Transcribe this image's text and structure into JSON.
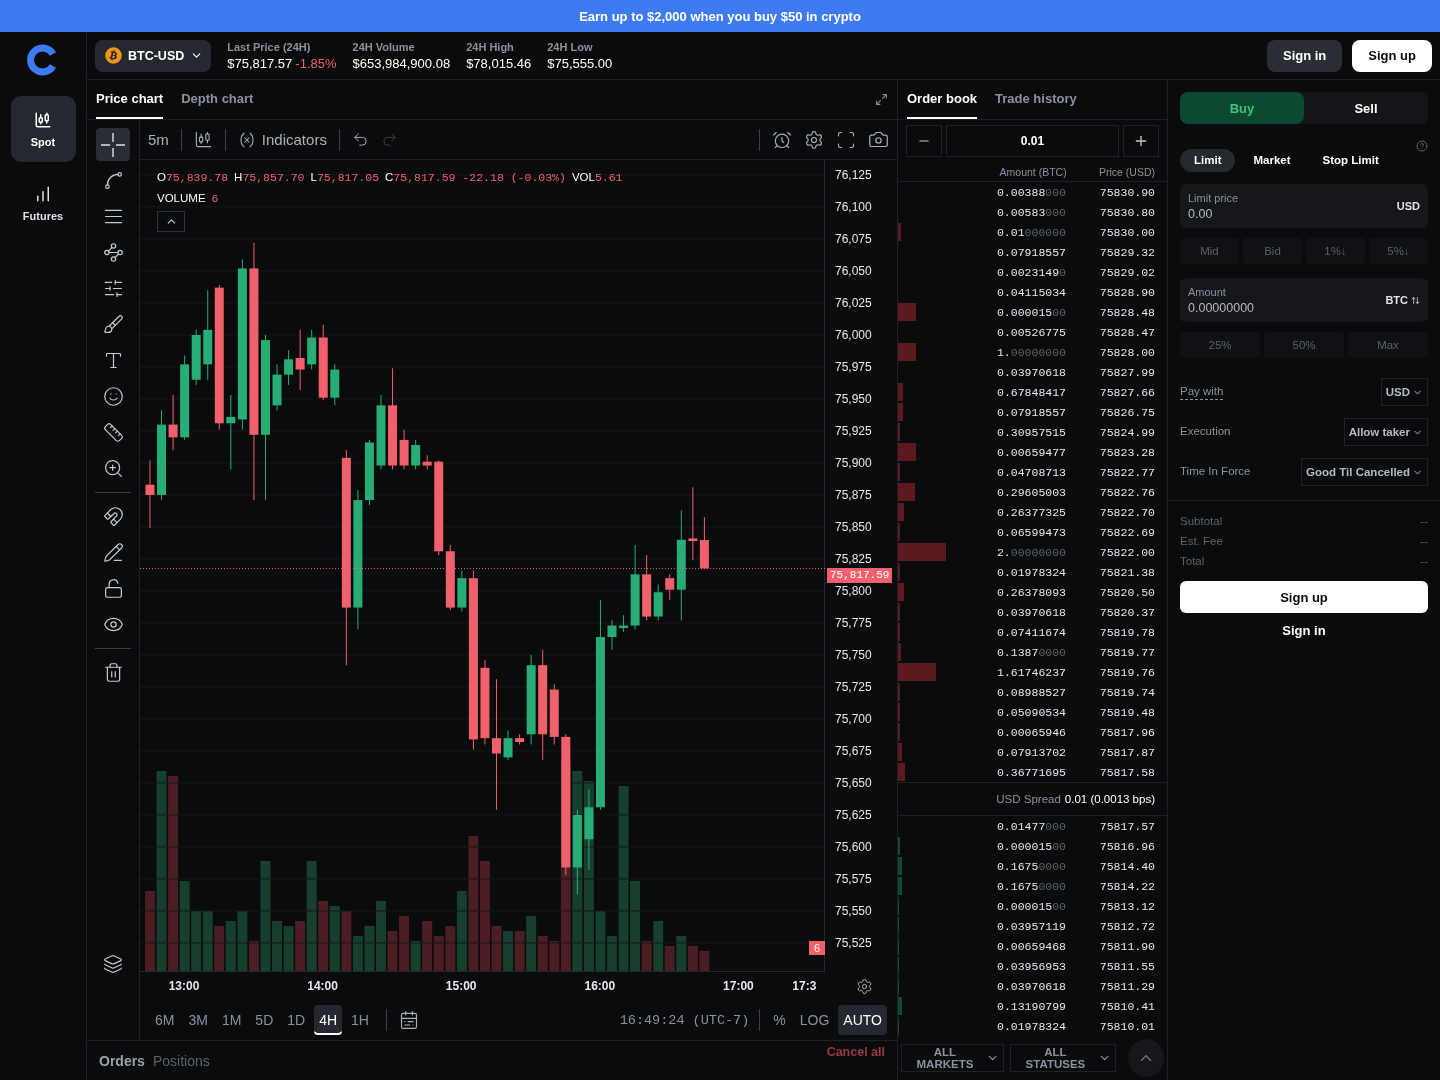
{
  "banner": {
    "text": "Earn up to $2,000 when you buy $50 in crypto"
  },
  "nav": [
    {
      "label": "Spot",
      "selected": true
    },
    {
      "label": "Futures",
      "selected": false
    }
  ],
  "header": {
    "pair": "BTC-USD",
    "stats": [
      {
        "label": "Last Price (24H)",
        "value": "$75,817.57",
        "change": "-1.85%"
      },
      {
        "label": "24H Volume",
        "value": "$653,984,900.08"
      },
      {
        "label": "24H High",
        "value": "$78,015.46"
      },
      {
        "label": "24H Low",
        "value": "$75,555.00"
      }
    ],
    "sign_in": "Sign in",
    "sign_up": "Sign up"
  },
  "chart": {
    "tabs": [
      {
        "label": "Price chart",
        "selected": true
      },
      {
        "label": "Depth chart",
        "selected": false
      }
    ],
    "interval": "5m",
    "indicators": "Indicators",
    "drawing_tools": [
      {
        "selected": true
      },
      {
        "selected": false
      },
      {
        "selected": false
      },
      {
        "selected": false
      },
      {
        "selected": false
      },
      {
        "selected": false
      },
      {
        "selected": false
      },
      {
        "selected": false
      },
      {
        "selected": false
      },
      {
        "selected": false
      },
      {
        "selected": false
      },
      {
        "selected": false
      },
      {
        "selected": false
      },
      {
        "selected": false
      },
      {
        "selected": false
      }
    ],
    "legend": [
      {
        "label": "O",
        "value": "75,839.78"
      },
      {
        "label": "H",
        "value": "75,857.70"
      },
      {
        "label": "L",
        "value": "75,817.05"
      },
      {
        "label": "C",
        "value": "75,817.59 -22.18 (-0.03%)"
      },
      {
        "label": "VOL",
        "value": "5.61"
      }
    ],
    "volume_legend": {
      "label": "VOLUME",
      "value": "6"
    },
    "chart_data": {
      "type": "candlestick",
      "x": [
        12.75,
        12.8333,
        12.9167,
        13,
        13.0833,
        13.1667,
        13.25,
        13.3333,
        13.4167,
        13.5,
        13.5833,
        13.6667,
        13.75,
        13.8333,
        13.9167,
        14,
        14.0833,
        14.1667,
        14.25,
        14.3333,
        14.4167,
        14.5,
        14.5833,
        14.6667,
        14.75,
        14.8333,
        14.9167,
        15,
        15.0833,
        15.1667,
        15.25,
        15.3333,
        15.4167,
        15.5,
        15.5833,
        15.6667,
        15.75,
        15.8333,
        15.9167,
        16,
        16.0833,
        16.1667,
        16.25,
        16.3333,
        16.4167,
        16.5,
        16.5833,
        16.6667,
        16.75
      ],
      "ohlc": [
        [
          75883,
          75902,
          75849,
          75875
        ],
        [
          75875,
          75941,
          75871,
          75930
        ],
        [
          75930,
          75953,
          75910,
          75920
        ],
        [
          75920,
          75984,
          75918,
          75977
        ],
        [
          75965,
          76004,
          75961,
          76000
        ],
        [
          75977,
          76035,
          75965,
          76004
        ],
        [
          76037,
          76039,
          75926,
          75931
        ],
        [
          75931,
          75953,
          75895,
          75936
        ],
        [
          75934,
          76059,
          75926,
          76052
        ],
        [
          76052,
          76072,
          75871,
          75922
        ],
        [
          75922,
          76000,
          75871,
          75996
        ],
        [
          75945,
          75977,
          75941,
          75969
        ],
        [
          75969,
          75988,
          75961,
          75981
        ],
        [
          75982,
          76004,
          75957,
          75973
        ],
        [
          75977,
          76004,
          75973,
          75998
        ],
        [
          75998,
          76008,
          75949,
          75951
        ],
        [
          75951,
          75977,
          75945,
          75973
        ],
        [
          75904,
          75910,
          75742,
          75787
        ],
        [
          75787,
          75879,
          75770,
          75871
        ],
        [
          75871,
          75918,
          75867,
          75916
        ],
        [
          75898,
          75953,
          75895,
          75945
        ],
        [
          75945,
          75974,
          75895,
          75898
        ],
        [
          75918,
          75926,
          75895,
          75898
        ],
        [
          75898,
          75918,
          75895,
          75914
        ],
        [
          75901,
          75906,
          75895,
          75898
        ],
        [
          75901,
          75902,
          75828,
          75831
        ],
        [
          75831,
          75836,
          75785,
          75787
        ],
        [
          75787,
          75816,
          75784,
          75810
        ],
        [
          75810,
          75816,
          75676,
          75684
        ],
        [
          75740,
          75746,
          75680,
          75685
        ],
        [
          75685,
          75731,
          75629,
          75673
        ],
        [
          75670,
          75691,
          75668,
          75685
        ],
        [
          75685,
          75688,
          75680,
          75682
        ],
        [
          75688,
          75750,
          75680,
          75742
        ],
        [
          75742,
          75754,
          75668,
          75688
        ],
        [
          75723,
          75727,
          75680,
          75686
        ],
        [
          75686,
          75688,
          75578,
          75584
        ],
        [
          75584,
          75629,
          75563,
          75625
        ],
        [
          75606,
          75645,
          75582,
          75631
        ],
        [
          75631,
          75793,
          75629,
          75764
        ],
        [
          75764,
          75777,
          75754,
          75773
        ],
        [
          75771,
          75781,
          75768,
          75773
        ],
        [
          75773,
          75836,
          75770,
          75813
        ],
        [
          75813,
          75828,
          75777,
          75780
        ],
        [
          75780,
          75805,
          75777,
          75799
        ],
        [
          75810,
          75813,
          75793,
          75801
        ],
        [
          75801,
          75863,
          75777,
          75840
        ],
        [
          75841,
          75881,
          75824,
          75839
        ],
        [
          75839.78,
          75857.7,
          75817.05,
          75817.59
        ]
      ],
      "xlim": [
        12.678,
        17.62
      ],
      "ylim": [
        75502.3,
        76136.7
      ],
      "grid": true,
      "ref_lines": [
        {
          "axis": "y",
          "value": 75817.59
        }
      ],
      "yticks": [
        {
          "value": 76125,
          "label": "76,125"
        },
        {
          "value": 76100,
          "label": "76,100"
        },
        {
          "value": 76075,
          "label": "76,075"
        },
        {
          "value": 76050,
          "label": "76,050"
        },
        {
          "value": 76025,
          "label": "76,025"
        },
        {
          "value": 76000,
          "label": "76,000"
        },
        {
          "value": 75975,
          "label": "75,975"
        },
        {
          "value": 75950,
          "label": "75,950"
        },
        {
          "value": 75925,
          "label": "75,925"
        },
        {
          "value": 75900,
          "label": "75,900"
        },
        {
          "value": 75875,
          "label": "75,875"
        },
        {
          "value": 75850,
          "label": "75,850"
        },
        {
          "value": 75825,
          "label": "75,825"
        },
        {
          "value": 75800,
          "label": "75,800"
        },
        {
          "value": 75775,
          "label": "75,775"
        },
        {
          "value": 75750,
          "label": "75,750"
        },
        {
          "value": 75725,
          "label": "75,725"
        },
        {
          "value": 75700,
          "label": "75,700"
        },
        {
          "value": 75675,
          "label": "75,675"
        },
        {
          "value": 75650,
          "label": "75,650"
        },
        {
          "value": 75625,
          "label": "75,625"
        },
        {
          "value": 75600,
          "label": "75,600"
        },
        {
          "value": 75575,
          "label": "75,575"
        },
        {
          "value": 75550,
          "label": "75,550"
        },
        {
          "value": 75525,
          "label": "75,525"
        }
      ],
      "xticks": [
        {
          "value": 13,
          "label": "13:00"
        },
        {
          "value": 14,
          "label": "14:00"
        },
        {
          "value": 15,
          "label": "15:00"
        },
        {
          "value": 16,
          "label": "16:00"
        },
        {
          "value": 17,
          "label": "17:00"
        },
        {
          "value": 17.5,
          "label": "17:3"
        }
      ]
    },
    "current_price_tag": "75,817.59",
    "volume_tag": "6",
    "ranges": [
      {
        "label": "6M",
        "selected": false
      },
      {
        "label": "3M",
        "selected": false
      },
      {
        "label": "1M",
        "selected": false
      },
      {
        "label": "5D",
        "selected": false
      },
      {
        "label": "1D",
        "selected": false
      },
      {
        "label": "4H",
        "selected": true
      },
      {
        "label": "1H",
        "selected": false
      }
    ],
    "timestamp": "16:49:24 (UTC-7)",
    "scale_options": [
      {
        "label": "%",
        "selected": false
      },
      {
        "label": "LOG",
        "selected": false
      },
      {
        "label": "AUTO",
        "selected": true
      }
    ]
  },
  "orders": {
    "tabs": [
      {
        "label": "Orders",
        "selected": true
      },
      {
        "label": "Positions",
        "selected": false
      }
    ],
    "cancel_all": "Cancel all",
    "filters": [
      "ALL MARKETS",
      "ALL STATUSES"
    ]
  },
  "order_book": {
    "tabs": [
      {
        "label": "Order book",
        "selected": true
      },
      {
        "label": "Trade history",
        "selected": false
      }
    ],
    "tick_size": "0.01",
    "columns": [
      "Amount (BTC)",
      "Price (USD)"
    ],
    "asks": [
      {
        "amount": "0.00388",
        "pad": "000",
        "price": "75830.90"
      },
      {
        "amount": "0.00583",
        "pad": "000",
        "price": "75830.80"
      },
      {
        "amount": "0.01",
        "pad": "000000",
        "price": "75830.00"
      },
      {
        "amount": "0.07918557",
        "price": "75829.32"
      },
      {
        "amount": "0.0023149",
        "pad": "0",
        "price": "75829.02"
      },
      {
        "amount": "0.04115034",
        "price": "75828.90"
      },
      {
        "amount": "0.000015",
        "pad": "00",
        "price": "75828.48"
      },
      {
        "amount": "0.00526775",
        "price": "75828.47"
      },
      {
        "amount": "1.",
        "pad": "00000000",
        "price": "75828.00"
      },
      {
        "amount": "0.03970618",
        "price": "75827.99"
      },
      {
        "amount": "0.67848417",
        "price": "75827.66"
      },
      {
        "amount": "0.07918557",
        "price": "75826.75"
      },
      {
        "amount": "0.30957515",
        "price": "75824.99"
      },
      {
        "amount": "0.00659477",
        "price": "75823.28"
      },
      {
        "amount": "0.04708713",
        "price": "75822.77"
      },
      {
        "amount": "0.29605003",
        "price": "75822.76"
      },
      {
        "amount": "0.26377325",
        "price": "75822.70"
      },
      {
        "amount": "0.06599473",
        "price": "75822.69"
      },
      {
        "amount": "2.",
        "pad": "00000000",
        "price": "75822.00"
      },
      {
        "amount": "0.01978324",
        "price": "75821.38"
      },
      {
        "amount": "0.26378093",
        "price": "75820.50"
      },
      {
        "amount": "0.03970618",
        "price": "75820.37"
      },
      {
        "amount": "0.07411674",
        "price": "75819.78"
      },
      {
        "amount": "0.1387",
        "pad": "0000",
        "price": "75819.77"
      },
      {
        "amount": "1.61746237",
        "price": "75819.76"
      },
      {
        "amount": "0.08988527",
        "price": "75819.74"
      },
      {
        "amount": "0.05090534",
        "price": "75819.48"
      },
      {
        "amount": "0.00065946",
        "price": "75817.96"
      },
      {
        "amount": "0.07913702",
        "price": "75817.87"
      },
      {
        "amount": "0.36771695",
        "price": "75817.58"
      }
    ],
    "spread": {
      "label": "USD Spread",
      "value": "0.01 (0.0013 bps)"
    },
    "bids": [
      {
        "amount": "0.01477",
        "pad": "000",
        "price": "75817.57"
      },
      {
        "amount": "0.000015",
        "pad": "00",
        "price": "75816.96"
      },
      {
        "amount": "0.1675",
        "pad": "0000",
        "price": "75814.40"
      },
      {
        "amount": "0.1675",
        "pad": "0000",
        "price": "75814.22"
      },
      {
        "amount": "0.000015",
        "pad": "00",
        "price": "75813.12"
      },
      {
        "amount": "0.03957119",
        "price": "75812.72"
      },
      {
        "amount": "0.00659468",
        "price": "75811.90"
      },
      {
        "amount": "0.03956953",
        "price": "75811.55"
      },
      {
        "amount": "0.03970618",
        "price": "75811.29"
      },
      {
        "amount": "0.13190799",
        "price": "75810.41"
      },
      {
        "amount": "0.01978324",
        "price": "75810.01"
      }
    ]
  },
  "trade": {
    "sides": [
      {
        "label": "Buy",
        "selected": true
      },
      {
        "label": "Sell",
        "selected": false
      }
    ],
    "order_types": [
      {
        "label": "Limit",
        "selected": true
      },
      {
        "label": "Market",
        "selected": false
      },
      {
        "label": "Stop Limit",
        "selected": false
      }
    ],
    "limit_price": {
      "label": "Limit price",
      "value": "0.00",
      "unit": "USD"
    },
    "price_shortcuts": [
      {
        "label": "Mid",
        "disabled": true
      },
      {
        "label": "Bid",
        "disabled": true
      },
      {
        "label": "1%↓",
        "disabled": true
      },
      {
        "label": "5%↓",
        "disabled": true
      }
    ],
    "amount": {
      "label": "Amount",
      "value": "0.00000000",
      "unit": "BTC"
    },
    "amount_shortcuts": [
      {
        "label": "25%",
        "disabled": true
      },
      {
        "label": "50%",
        "disabled": true
      },
      {
        "label": "Max",
        "disabled": true
      }
    ],
    "settings": [
      {
        "label": "Pay with",
        "value": "USD",
        "underlined": true
      },
      {
        "label": "Execution",
        "value": "Allow taker",
        "underlined": false
      },
      {
        "label": "Time In Force",
        "value": "Good Til Cancelled",
        "underlined": false
      }
    ],
    "summary": [
      {
        "label": "Subtotal",
        "value": "--"
      },
      {
        "label": "Est. Fee",
        "value": "--"
      },
      {
        "label": "Total",
        "value": "--"
      }
    ],
    "primary_button": "Sign up",
    "secondary_button": "Sign in"
  }
}
